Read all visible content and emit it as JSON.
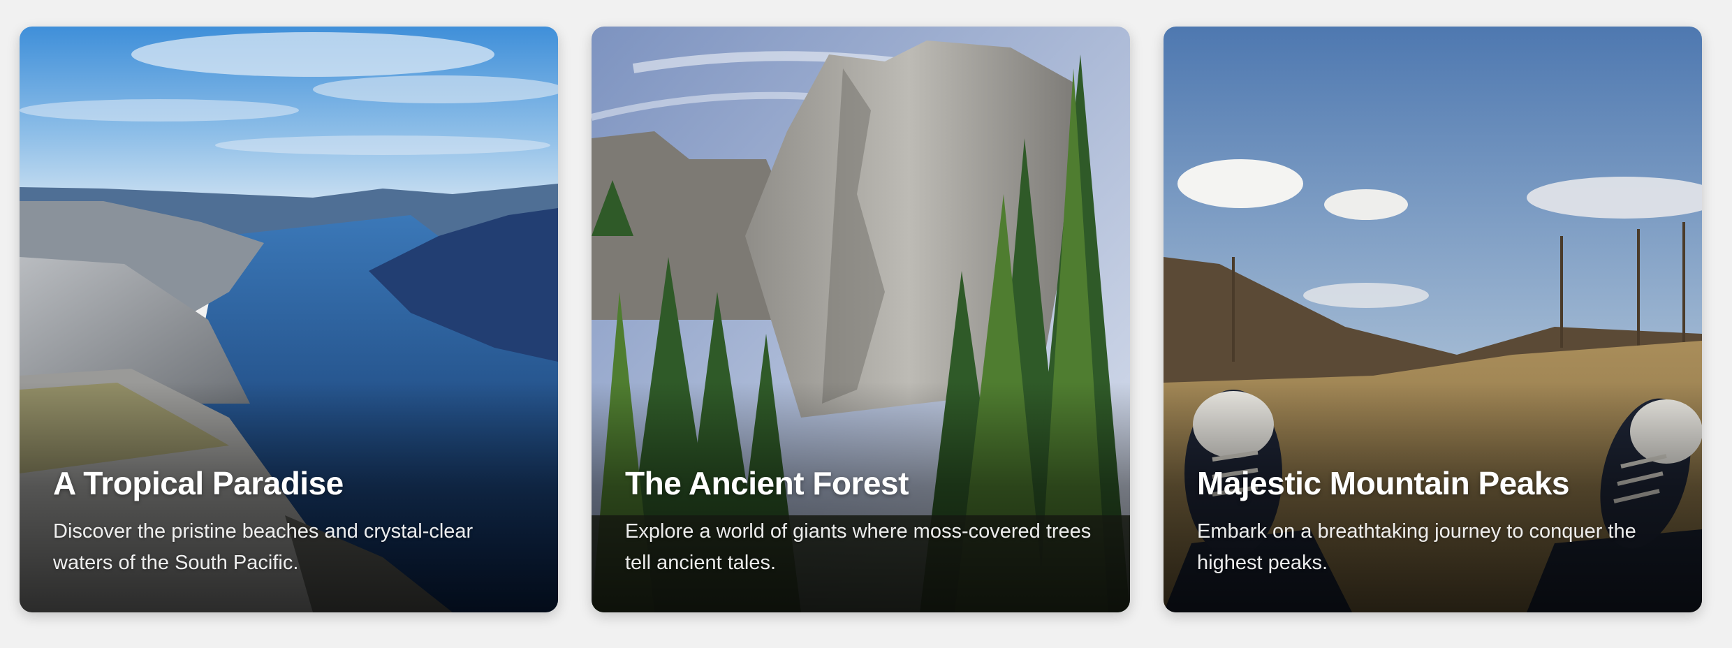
{
  "cards": [
    {
      "title": "A Tropical Paradise",
      "description": "Discover the pristine beaches and crystal-clear waters of the South Pacific.",
      "image": "fjord-landscape"
    },
    {
      "title": "The Ancient Forest",
      "description": "Explore a world of giants where moss-covered trees tell ancient tales.",
      "image": "granite-cliff-forest"
    },
    {
      "title": "Majestic Mountain Peaks",
      "description": "Embark on a breathtaking journey to conquer the highest peaks.",
      "image": "park-sneakers-field"
    }
  ],
  "colors": {
    "page_background": "#f1f1f1",
    "caption_text": "#ffffff"
  }
}
